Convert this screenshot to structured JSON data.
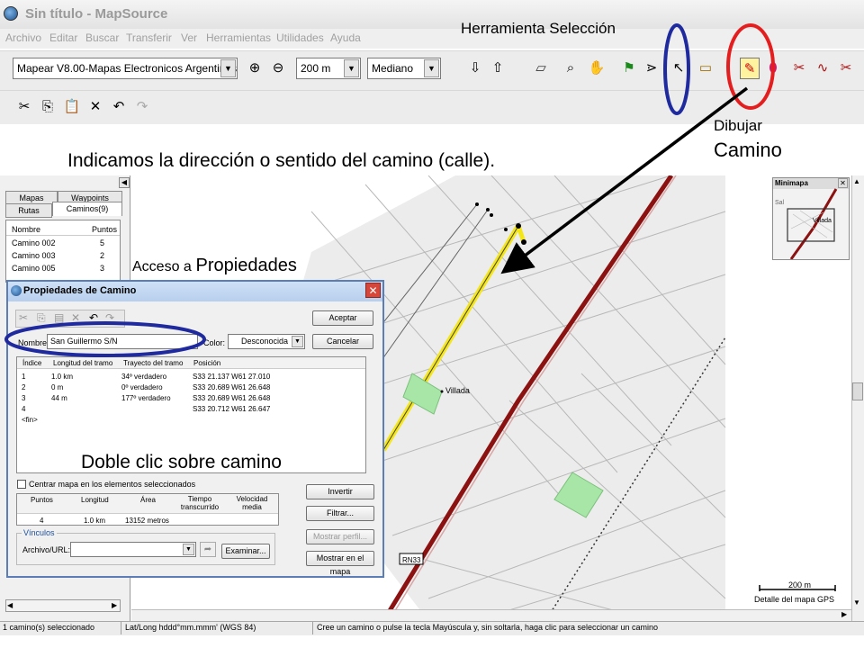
{
  "window": {
    "title": "Sin título - MapSource"
  },
  "menu": [
    "Archivo",
    "Editar",
    "Buscar",
    "Transferir",
    "Ver",
    "Herramientas",
    "Utilidades",
    "Ayuda"
  ],
  "toolbar": {
    "map_product": "Mapear V8.00-Mapas Electronicos Argentinos",
    "zoom_scale": "200 m",
    "detail_level": "Mediano"
  },
  "annotations": {
    "select_tool": "Herramienta Selección",
    "draw_line1": "Dibujar",
    "draw_line2": "Camino",
    "direction": "Indicamos la dirección o sentido del camino (calle).",
    "properties_prefix": "Acceso a",
    "properties_word": "Propiedades",
    "double_click": "Doble clic sobre camino"
  },
  "left_panel": {
    "tabs": [
      "Mapas",
      "Waypoints",
      "Rutas",
      "Caminos(9)"
    ],
    "columns": [
      "Nombre",
      "Puntos"
    ],
    "rows": [
      {
        "name": "Camino 002",
        "points": "5"
      },
      {
        "name": "Camino 003",
        "points": "2"
      },
      {
        "name": "Camino 005",
        "points": "3"
      }
    ]
  },
  "dialog": {
    "title": "Propiedades de Camino",
    "name_label": "Nombre:",
    "name_value": "San Guillermo S/N",
    "color_label": "Color:",
    "color_value": "Desconocida",
    "accept": "Aceptar",
    "cancel": "Cancelar",
    "columns": [
      "Índice",
      "Longitud del tramo",
      "Trayecto del tramo",
      "Posición"
    ],
    "legs": [
      {
        "index": "1",
        "length": "1.0 km",
        "course": "34º verdadero",
        "position": "S33 21.137 W61 27.010"
      },
      {
        "index": "2",
        "length": "0 m",
        "course": "0º verdadero",
        "position": "S33 20.689 W61 26.648"
      },
      {
        "index": "3",
        "length": "44 m",
        "course": "177º verdadero",
        "position": "S33 20.689 W61 26.648"
      },
      {
        "index": "4",
        "length": "",
        "course": "",
        "position": "S33 20.712 W61 26.647"
      },
      {
        "index": "<fin>",
        "length": "",
        "course": "",
        "position": ""
      }
    ],
    "center_map": "Centrar mapa en los elementos seleccionados",
    "invert": "Invertir",
    "filter": "Filtrar...",
    "show_profile": "Mostrar perfil...",
    "show_on_map": "Mostrar en el mapa",
    "summary_headers": [
      "Puntos",
      "Longitud",
      "Área",
      "Tiempo transcurrido",
      "Velocidad media"
    ],
    "summary_values": [
      "4",
      "1.0 km",
      "13152 metros",
      "",
      ""
    ],
    "links_label": "Vínculos",
    "file_label": "Archivo/URL:",
    "browse": "Examinar..."
  },
  "map": {
    "place_label": "Villada",
    "road_label": "RN33",
    "scale_label": "200 m",
    "detail_label": "Detalle del mapa GPS"
  },
  "minimap": {
    "title": "Minimapa",
    "place_label": "Villada"
  },
  "status": {
    "selection": "1 camino(s) seleccionado",
    "coords_format": "Lat/Long hddd°mm.mmm' (WGS 84)",
    "hint": "Cree un camino o pulse la tecla Mayúscula y, sin soltarla, haga clic para seleccionar un camino"
  },
  "colors": {
    "selected_track": "#f5e617",
    "route": "#b31b1b",
    "highlight_blue": "#1f2a9e",
    "highlight_red": "#e41e1e",
    "park": "#a8e6a8"
  }
}
